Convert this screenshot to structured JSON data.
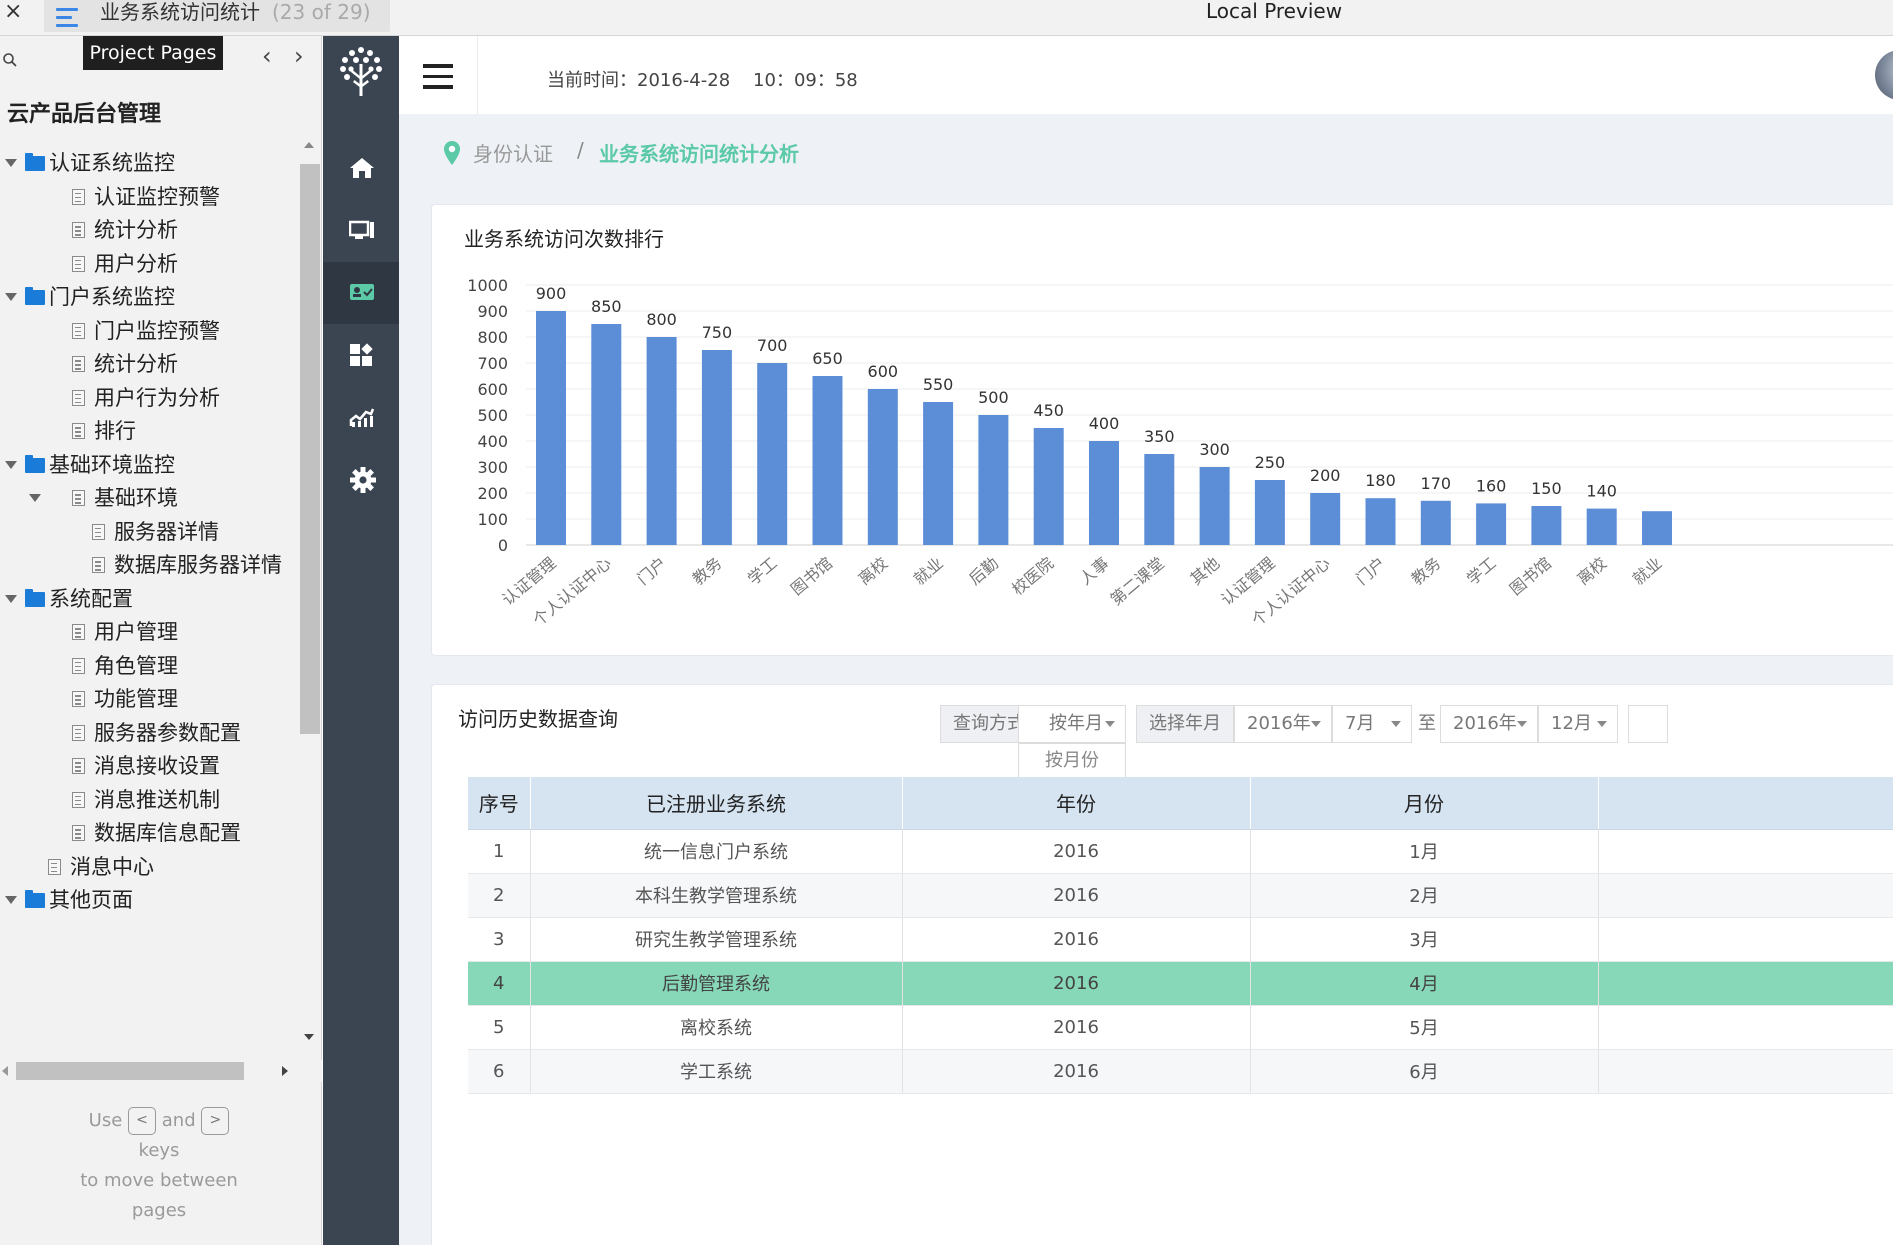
{
  "preview": {
    "tab_title": "业务系统访问统计",
    "tab_count": "(23 of 29)",
    "window_title": "Local Preview",
    "close_symbol": "×"
  },
  "sitemap": {
    "tooltip": "Project Pages",
    "prev_symbol": "‹",
    "next_symbol": "›",
    "project": "云产品后台管理",
    "nodes": [
      {
        "label": "认证系统监控",
        "type": "folder",
        "level": 0,
        "expanded": true
      },
      {
        "label": "认证监控预警",
        "type": "page",
        "level": 1
      },
      {
        "label": "统计分析",
        "type": "page",
        "level": 1
      },
      {
        "label": "用户分析",
        "type": "page",
        "level": 1
      },
      {
        "label": "门户系统监控",
        "type": "folder",
        "level": 0,
        "expanded": true
      },
      {
        "label": "门户监控预警",
        "type": "page",
        "level": 1
      },
      {
        "label": "统计分析",
        "type": "page",
        "level": 1
      },
      {
        "label": "用户行为分析",
        "type": "page",
        "level": 1
      },
      {
        "label": "排行",
        "type": "page",
        "level": 1
      },
      {
        "label": "基础环境监控",
        "type": "folder",
        "level": 0,
        "expanded": true
      },
      {
        "label": "基础环境",
        "type": "page",
        "level": 1,
        "expanded": true
      },
      {
        "label": "服务器详情",
        "type": "page",
        "level": 2
      },
      {
        "label": "数据库服务器详情",
        "type": "page",
        "level": 2
      },
      {
        "label": "系统配置",
        "type": "folder",
        "level": 0,
        "expanded": true
      },
      {
        "label": "用户管理",
        "type": "page",
        "level": 1
      },
      {
        "label": "角色管理",
        "type": "page",
        "level": 1
      },
      {
        "label": "功能管理",
        "type": "page",
        "level": 1
      },
      {
        "label": "服务器参数配置",
        "type": "page",
        "level": 1
      },
      {
        "label": "消息接收设置",
        "type": "page",
        "level": 1
      },
      {
        "label": "消息推送机制",
        "type": "page",
        "level": 1
      },
      {
        "label": "数据库信息配置",
        "type": "page",
        "level": 1
      },
      {
        "label": "消息中心",
        "type": "page",
        "level": 0
      },
      {
        "label": "其他页面",
        "type": "folder",
        "level": 0,
        "expanded": true
      }
    ],
    "hint": {
      "use": "Use",
      "key_prev": "<",
      "and": "and",
      "key_next": ">",
      "keys": "keys",
      "rest": "to move between",
      "pages": "pages"
    }
  },
  "rail": {
    "items": [
      "home-icon",
      "monitor-icon",
      "id-card-icon",
      "apps-icon",
      "chart-icon",
      "gear-icon"
    ],
    "active_index": 2,
    "colors": {
      "bg": "#3b4552",
      "active": "#2f3842"
    }
  },
  "header": {
    "clock": "当前时间：2016-4-28    10：09：58"
  },
  "breadcrumb": {
    "parent": "身份认证",
    "separator": "/",
    "current": "业务系统访问统计分析",
    "accent": "#5cc9a7"
  },
  "chart_card": {
    "title": "业务系统访问次数排行"
  },
  "chart_data": {
    "type": "bar",
    "title": "业务系统访问次数排行",
    "categories": [
      "认证管理",
      "个人认证中心",
      "门户",
      "教务",
      "学工",
      "图书馆",
      "离校",
      "就业",
      "后勤",
      "校医院",
      "人事",
      "第二课堂",
      "其他",
      "认证管理",
      "个人认证中心",
      "门户",
      "教务",
      "学工",
      "图书馆",
      "离校",
      "就业"
    ],
    "values": [
      900,
      850,
      800,
      750,
      700,
      650,
      600,
      550,
      500,
      450,
      400,
      350,
      300,
      250,
      200,
      180,
      170,
      160,
      150,
      140,
      130
    ],
    "data_labels": [
      "900",
      "850",
      "800",
      "750",
      "700",
      "650",
      "600",
      "550",
      "500",
      "450",
      "400",
      "350",
      "300",
      "250",
      "200",
      "180",
      "170",
      "160",
      "150",
      "140",
      ""
    ],
    "ylim": [
      0,
      1000
    ],
    "yticks": [
      0,
      100,
      200,
      300,
      400,
      500,
      600,
      700,
      800,
      900,
      1000
    ],
    "grid": true,
    "color": "#5b8ed6"
  },
  "query": {
    "title": "访问历史数据查询",
    "method_label": "查询方式",
    "method_value": "按年月",
    "method_option": "按月份",
    "select_label": "选择年月",
    "start_year": "2016年",
    "start_month": "7月",
    "to": "至",
    "end_year": "2016年",
    "end_month": "12月"
  },
  "table": {
    "headers": [
      "序号",
      "已注册业务系统",
      "年份",
      "月份"
    ],
    "rows": [
      {
        "seq": "1",
        "system": "统一信息门户系统",
        "year": "2016",
        "month": "1月"
      },
      {
        "seq": "2",
        "system": "本科生教学管理系统",
        "year": "2016",
        "month": "2月"
      },
      {
        "seq": "3",
        "system": "研究生教学管理系统",
        "year": "2016",
        "month": "3月"
      },
      {
        "seq": "4",
        "system": "后勤管理系统",
        "year": "2016",
        "month": "4月"
      },
      {
        "seq": "5",
        "system": "离校系统",
        "year": "2016",
        "month": "5月"
      },
      {
        "seq": "6",
        "system": "学工系统",
        "year": "2016",
        "month": "6月"
      }
    ],
    "highlight_row": 3,
    "highlight_color": "#86d8b8"
  }
}
